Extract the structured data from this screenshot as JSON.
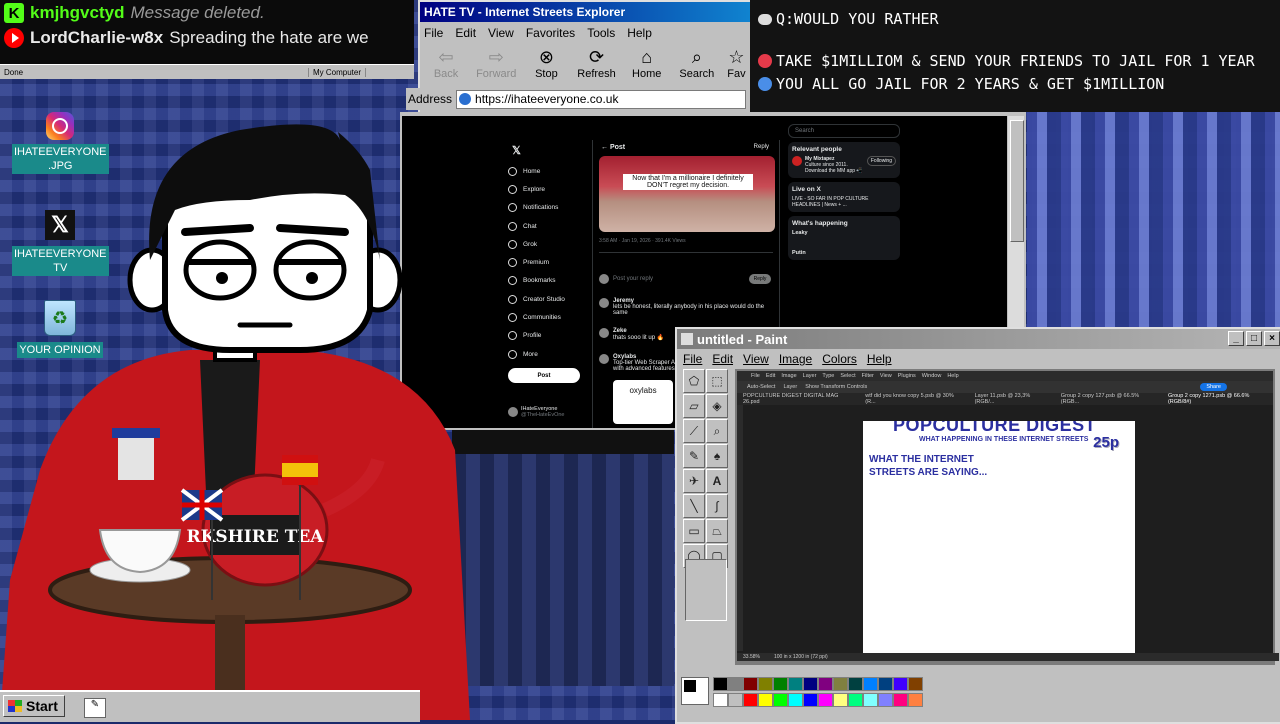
{
  "chat": {
    "messages": [
      {
        "platform_icon": "kick-icon",
        "name": "kmjhgvctyd",
        "text": "Message deleted.",
        "name_color": "#53fc18"
      },
      {
        "platform_icon": "youtube-icon",
        "name": "LordCharlie-w8x",
        "text": "Spreading the hate are we"
      }
    ],
    "status_left": "Done",
    "status_right": "My Computer"
  },
  "desktop_icons": [
    {
      "icon": "instagram-icon",
      "label": "IHATEEVERYONE .JPG"
    },
    {
      "icon": "x-icon",
      "label": "IHATEEVERYONE TV"
    },
    {
      "icon": "recycle-bin-icon",
      "label": "YOUR OPINION"
    }
  ],
  "browser": {
    "title": "HATE TV - Internet Streets Explorer",
    "menu": [
      "File",
      "Edit",
      "View",
      "Favorites",
      "Tools",
      "Help"
    ],
    "toolbar": [
      {
        "label": "Back",
        "icon": "back-arrow-icon",
        "enabled": false
      },
      {
        "label": "Forward",
        "icon": "forward-arrow-icon",
        "enabled": false
      },
      {
        "label": "Stop",
        "icon": "stop-icon",
        "enabled": true
      },
      {
        "label": "Refresh",
        "icon": "refresh-icon",
        "enabled": true
      },
      {
        "label": "Home",
        "icon": "home-icon",
        "enabled": true
      },
      {
        "label": "Search",
        "icon": "search-icon",
        "enabled": true
      },
      {
        "label": "Fav",
        "icon": "favorites-icon",
        "enabled": true
      }
    ],
    "address_label": "Address",
    "address": "https://ihateeveryone.co.uk"
  },
  "question": {
    "title": "Q:WOULD YOU RATHER",
    "options": [
      {
        "color": "#e53a4a",
        "text": "TAKE $1MILLIOM & SEND YOUR FRIENDS TO JAIL FOR 1 YEAR"
      },
      {
        "color": "#4a8ee8",
        "text": "YOU ALL GO JAIL FOR 2 YEARS & GET $1MILLION"
      }
    ]
  },
  "x_page": {
    "nav": [
      "Home",
      "Explore",
      "Notifications",
      "Chat",
      "Grok",
      "Premium",
      "Bookmarks",
      "Creator Studio",
      "Communities",
      "Profile",
      "More"
    ],
    "post_button": "Post",
    "header": "Post",
    "reply_label": "Reply",
    "image_caption": "Now that I'm a millionaire I definitely DON'T regret my decision.",
    "post_meta": "3:58 AM · Jan 19, 2026 · 391.4K Views",
    "compose_placeholder": "Post your reply",
    "replies": [
      {
        "name": "Jeremy",
        "text": "lets be honest, literally anybody in his place would do the same"
      },
      {
        "name": "Zeke",
        "text": "thats sooo lit up 🔥"
      },
      {
        "name": "Oxylabs",
        "text": "Top-tier Web Scraper API with advanced features."
      }
    ],
    "ad_label": "oxylabs",
    "search_placeholder": "Search",
    "sidebar": {
      "relevant_title": "Relevant people",
      "relevant_name": "My Mixtapez",
      "relevant_desc": "Culture since 2011. Download the MM app 📲",
      "follow_label": "Following",
      "live_title": "Live on X",
      "live_text": "LIVE - SO FAR IN POP CULTURE HEADLINES | News + ...",
      "happening_title": "What's happening",
      "trends": [
        "Leaky",
        "Putin"
      ]
    },
    "profile_name": "IHateEveryone",
    "profile_handle": "@TheHateEvOne"
  },
  "paint": {
    "title": "untitled - Paint",
    "menu": [
      "File",
      "Edit",
      "View",
      "Image",
      "Colors",
      "Help"
    ],
    "photoshop": {
      "menu": [
        "File",
        "Edit",
        "Image",
        "Layer",
        "Type",
        "Select",
        "Filter",
        "View",
        "Plugins",
        "Window",
        "Help"
      ],
      "options": [
        "Auto-Select",
        "Layer",
        "Show Transform Controls"
      ],
      "share_label": "Share",
      "tabs": [
        "POPCULTURE DIGEST DIGITAL MAG 26.psd",
        "wtf did you know copy 5.psb @ 30% (R...",
        "Layer 11.psb @ 23,3% (RGB/...",
        "Group 2 copy 127.psb @ 66.5% (RGB...",
        "Group 2 copy 1271.psb @ 66.6% (RGB/8#)"
      ],
      "zoom": "33.58%",
      "doc_size": "100 in x 1200 in (72 ppi)"
    },
    "artwork": {
      "headline": "POPCULTURE DIGEST",
      "subhead": "WHAT HAPPENING IN THESE INTERNET STREETS",
      "price": "25p",
      "body": "WHAT THE INTERNET STREETS ARE SAYING..."
    },
    "palette_colors": [
      "#000000",
      "#808080",
      "#800000",
      "#808000",
      "#008000",
      "#008080",
      "#000080",
      "#800080",
      "#808040",
      "#004040",
      "#0080ff",
      "#004080",
      "#4000ff",
      "#804000",
      "#ffffff",
      "#c0c0c0",
      "#ff0000",
      "#ffff00",
      "#00ff00",
      "#00ffff",
      "#0000ff",
      "#ff00ff",
      "#ffff80",
      "#00ff80",
      "#80ffff",
      "#8080ff",
      "#ff0080",
      "#ff8040"
    ]
  },
  "taskbar": {
    "start_label": "Start"
  },
  "character": {
    "tray_label": "RKSHIRE TEA"
  }
}
